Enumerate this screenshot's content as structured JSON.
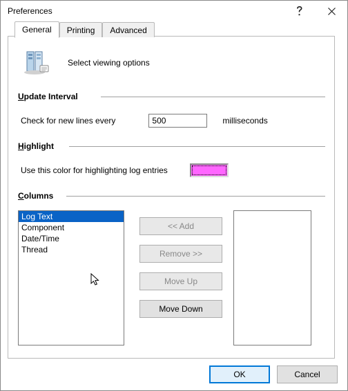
{
  "window": {
    "title": "Preferences"
  },
  "tabs": {
    "general": "General",
    "printing": "Printing",
    "advanced": "Advanced"
  },
  "intro": {
    "text": "Select viewing options"
  },
  "update": {
    "title": "Update Interval",
    "label": "Check for new lines every",
    "value": "500",
    "unit": "milliseconds"
  },
  "highlight": {
    "title": "Highlight",
    "label": "Use this color for highlighting log entries",
    "color": "#ff66ff"
  },
  "columns": {
    "title": "Columns",
    "available": [
      "Log Text",
      "Component",
      "Date/Time",
      "Thread"
    ],
    "selected_index": 0,
    "chosen": [],
    "btn_add": "<< Add",
    "btn_remove": "Remove >>",
    "btn_up": "Move Up",
    "btn_down": "Move Down"
  },
  "footer": {
    "ok": "OK",
    "cancel": "Cancel"
  }
}
